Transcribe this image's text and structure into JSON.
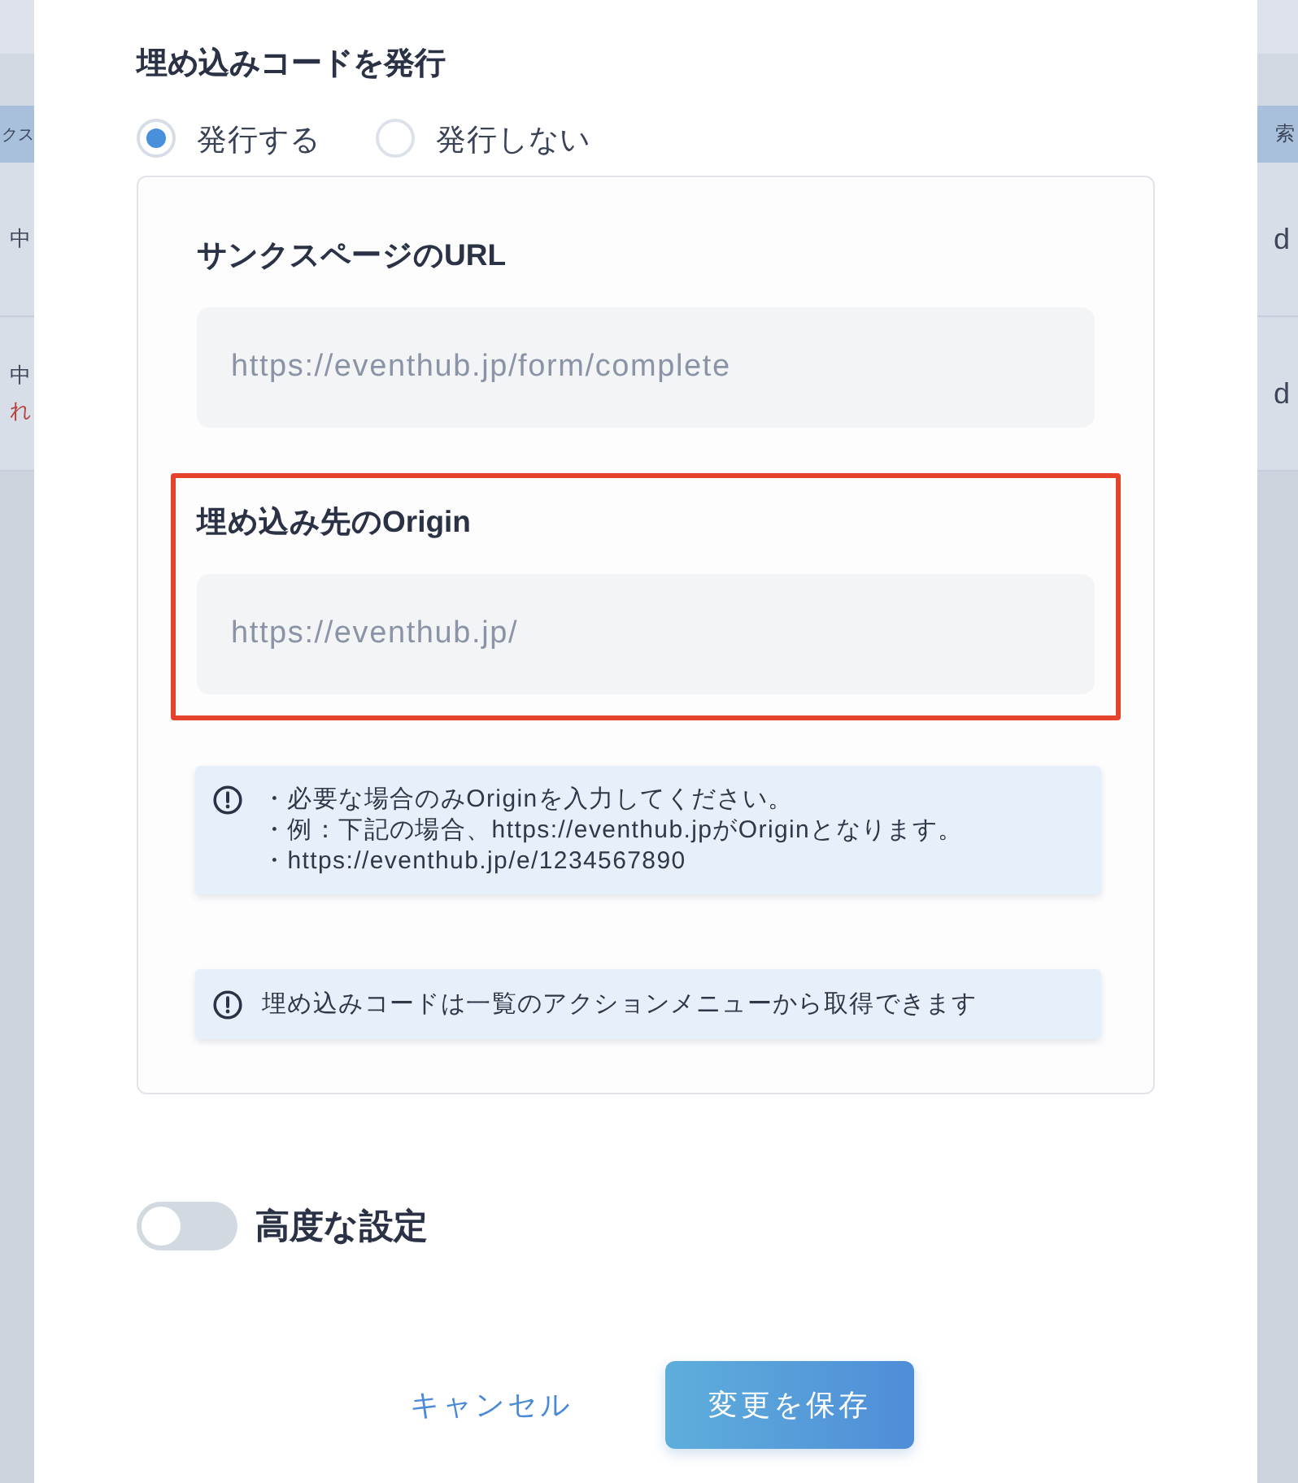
{
  "background_table": {
    "header": {
      "left": "クス",
      "right": "索"
    },
    "rows": [
      {
        "left": [
          {
            "text": "中",
            "kind": "status"
          }
        ],
        "right": "d"
      },
      {
        "left": [
          {
            "text": "中",
            "kind": "status"
          },
          {
            "text": "れ",
            "kind": "warning"
          }
        ],
        "right": "d"
      }
    ]
  },
  "modal": {
    "section_title": "埋め込みコードを発行",
    "options": [
      {
        "label": "発行する",
        "selected": true
      },
      {
        "label": "発行しない",
        "selected": false
      }
    ],
    "fields": [
      {
        "label": "サンクスページのURL",
        "placeholder": "https://eventhub.jp/form/complete",
        "highlighted": false
      },
      {
        "label": "埋め込み先のOrigin",
        "placeholder": "https://eventhub.jp/",
        "highlighted": true
      }
    ],
    "notices": [
      {
        "lines": [
          "・必要な場合のみOriginを入力してください。",
          "・例：下記の場合、https://eventhub.jpがOriginとなります。",
          "・https://eventhub.jp/e/1234567890"
        ]
      },
      {
        "lines": [
          "埋め込みコードは一覧のアクションメニューから取得できます"
        ]
      }
    ],
    "advanced_toggle": {
      "label": "高度な設定",
      "on": false
    },
    "buttons": [
      {
        "label": "キャンセル",
        "kind": "text"
      },
      {
        "label": "変更を保存",
        "kind": "primary"
      }
    ]
  }
}
